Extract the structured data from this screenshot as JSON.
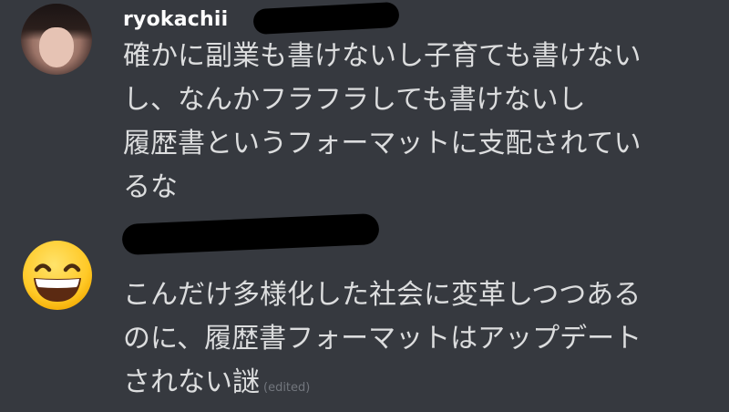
{
  "messages": [
    {
      "username": "ryokachii",
      "timestamp": "",
      "avatar": {
        "type": "photo",
        "icon": "user-photo-avatar"
      },
      "lines": [
        "確かに副業も書けないし子育ても書けない",
        "し、なんかフラフラしても書けないし",
        "履歴書というフォーマットに支配されてい",
        "るな"
      ],
      "edited": ""
    },
    {
      "username": "",
      "timestamp": "",
      "avatar": {
        "type": "emoji",
        "icon": "grinning-face-emoji",
        "glyph": "😄"
      },
      "lines": [
        "こんだけ多様化した社会に変革しつつある",
        "のに、履歴書フォーマットはアップデート",
        "されない謎"
      ],
      "edited": "(edited)"
    }
  ],
  "colors": {
    "background": "#36393f",
    "username": "#ffffff",
    "text": "#dcddde",
    "muted": "#72767d",
    "redaction": "#000000"
  }
}
